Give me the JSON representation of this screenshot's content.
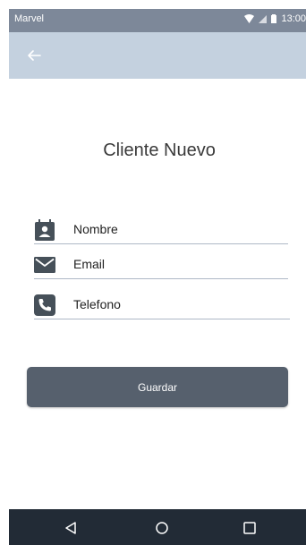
{
  "status_bar": {
    "carrier": "Marvel",
    "time": "13:00"
  },
  "app_bar": {
    "back_icon": "arrow-left-icon"
  },
  "page": {
    "title": "Cliente Nuevo"
  },
  "form": {
    "fields": [
      {
        "placeholder": "Nombre",
        "value": "",
        "icon": "contact-calendar-icon"
      },
      {
        "placeholder": "Email",
        "value": "",
        "icon": "mail-icon"
      },
      {
        "placeholder": "Telefono",
        "value": "",
        "icon": "phone-icon"
      }
    ],
    "submit_label": "Guardar"
  },
  "nav_bar": {
    "icons": [
      "nav-back-icon",
      "nav-home-icon",
      "nav-recents-icon"
    ]
  },
  "colors": {
    "status_bar": "#7d8899",
    "app_bar": "#c4d1df",
    "button": "#56606d",
    "nav_bar": "#222b36",
    "icon": "#465059"
  }
}
